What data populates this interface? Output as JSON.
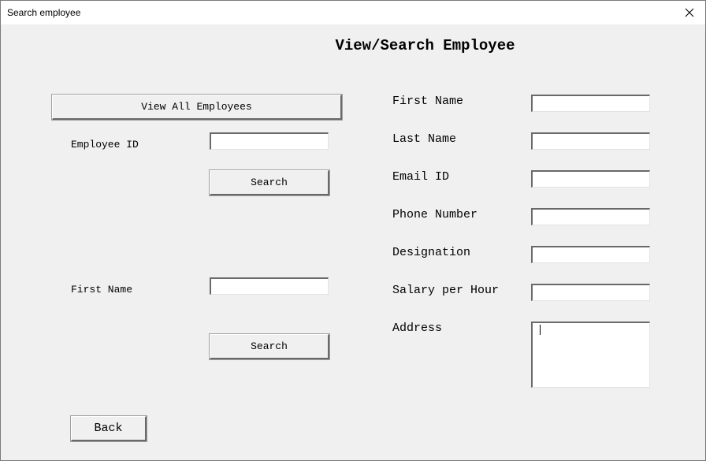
{
  "window": {
    "title": "Search employee"
  },
  "heading": "View/Search Employee",
  "left": {
    "view_all_label": "View All Employees",
    "employee_id_label": "Employee ID",
    "employee_id_value": "",
    "search1_label": "Search",
    "first_name_label": "First Name",
    "first_name_value": "",
    "search2_label": "Search",
    "back_label": "Back"
  },
  "right": {
    "fields": [
      {
        "label": "First Name",
        "value": ""
      },
      {
        "label": "Last Name",
        "value": ""
      },
      {
        "label": "Email ID",
        "value": ""
      },
      {
        "label": "Phone Number",
        "value": ""
      },
      {
        "label": "Designation",
        "value": ""
      },
      {
        "label": "Salary per Hour",
        "value": ""
      }
    ],
    "address_label": "Address",
    "address_value": ""
  },
  "icons": {
    "close": "close-icon"
  }
}
